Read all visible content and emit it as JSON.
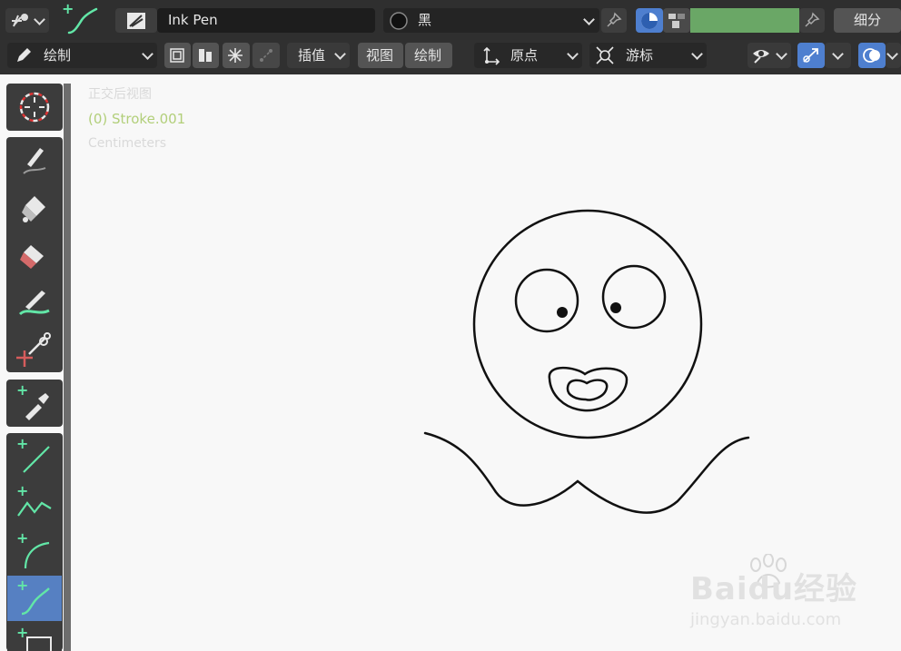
{
  "header": {
    "brush_name": "Ink Pen",
    "material_name": "黑",
    "subdivide_label": "细分",
    "color_hex": "#6aa766"
  },
  "toolbar": {
    "mode_label": "绘制",
    "interpolate_label": "插值",
    "view_label": "视图",
    "draw_label": "绘制",
    "origin_label": "原点",
    "cursor_label": "游标"
  },
  "overlay": {
    "view_name": "正交后视图",
    "object_name": "(0) Stroke.001",
    "units": "Centimeters"
  },
  "tools": [
    {
      "name": "cursor-tool"
    },
    {
      "name": "draw-tool"
    },
    {
      "name": "fill-tool"
    },
    {
      "name": "erase-tool"
    },
    {
      "name": "tint-tool"
    },
    {
      "name": "cutter-tool"
    },
    {
      "name": "eyedropper-tool"
    },
    {
      "name": "line-tool"
    },
    {
      "name": "polyline-tool"
    },
    {
      "name": "arc-tool"
    },
    {
      "name": "curve-tool",
      "active": true
    },
    {
      "name": "box-tool"
    }
  ],
  "watermark": {
    "brand": "Baidu经验",
    "url": "jingyan.baidu.com"
  }
}
